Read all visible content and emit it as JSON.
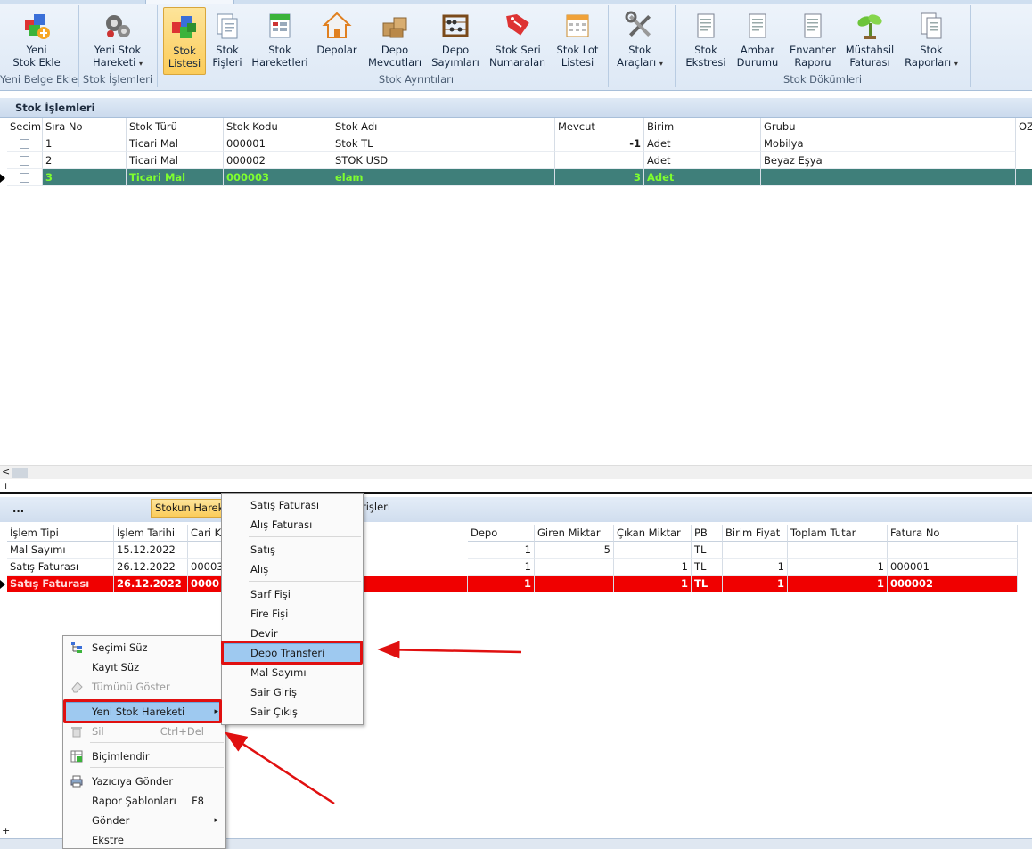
{
  "ribbon": {
    "groups": [
      {
        "label": "Yeni Belge Ekle"
      },
      {
        "label": "Stok İşlemleri"
      },
      {
        "label": "Stok Ayrıntıları"
      },
      {
        "label": "Stok Dökümleri"
      }
    ],
    "buttons": [
      {
        "line1": "Yeni",
        "line2": "Stok Ekle",
        "icon": "add-stock-icon"
      },
      {
        "line1": "Yeni Stok",
        "line2": "Hareketi",
        "icon": "gears-icon",
        "dropdown": "▾"
      },
      {
        "line1": "Stok",
        "line2": "Listesi",
        "icon": "cubes-icon"
      },
      {
        "line1": "Stok",
        "line2": "Fişleri",
        "icon": "documents-icon"
      },
      {
        "line1": "Stok",
        "line2": "Hareketleri",
        "icon": "spreadsheet-icon"
      },
      {
        "line1": "Depolar",
        "line2": "",
        "icon": "house-icon"
      },
      {
        "line1": "Depo",
        "line2": "Mevcutları",
        "icon": "boxes-icon"
      },
      {
        "line1": "Depo",
        "line2": "Sayımları",
        "icon": "abacus-icon"
      },
      {
        "line1": "Stok Seri",
        "line2": "Numaraları",
        "icon": "tag-icon"
      },
      {
        "line1": "Stok Lot",
        "line2": "Listesi",
        "icon": "calendar-icon"
      },
      {
        "line1": "Stok",
        "line2": "Araçları",
        "icon": "tools-icon",
        "dropdown": "▾"
      },
      {
        "line1": "Stok",
        "line2": "Ekstresi",
        "icon": "report-icon"
      },
      {
        "line1": "Ambar",
        "line2": "Durumu",
        "icon": "report-icon"
      },
      {
        "line1": "Envanter",
        "line2": "Raporu",
        "icon": "report-icon"
      },
      {
        "line1": "Müstahsil",
        "line2": "Faturası",
        "icon": "plant-icon"
      },
      {
        "line1": "Stok",
        "line2": "Raporları",
        "icon": "reports-icon",
        "dropdown": "▾"
      }
    ]
  },
  "stock_panel": {
    "title": "Stok İşlemleri",
    "columns": [
      "Secim",
      "Sıra No",
      "Stok Türü",
      "Stok Kodu",
      "Stok Adı",
      "Mevcut",
      "Birim",
      "Grubu",
      "OZ"
    ],
    "rows": [
      [
        "",
        "1",
        "Ticari Mal",
        "000001",
        "Stok TL",
        "-1",
        "Adet",
        "Mobilya"
      ],
      [
        "",
        "2",
        "Ticari Mal",
        "000002",
        "STOK USD",
        "",
        "Adet",
        "Beyaz Eşya"
      ],
      [
        "",
        "3",
        "Ticari Mal",
        "000003",
        "elam",
        "3",
        "Adet",
        ""
      ]
    ]
  },
  "lower_panel": {
    "more_label": "...",
    "tab_active": "Stokun Hareke",
    "tab_other": "rişleri",
    "columns": [
      "İşlem Tipi",
      "İşlem Tarihi",
      "Cari Ko",
      "Depo",
      "Giren Miktar",
      "Çıkan Miktar",
      "PB",
      "Birim Fiyat",
      "Toplam Tutar",
      "Fatura No"
    ],
    "rows": [
      [
        "Mal Sayımı",
        "15.12.2022",
        "",
        "1",
        "5",
        "",
        "TL",
        "",
        "",
        ""
      ],
      [
        "Satış Faturası",
        "26.12.2022",
        "00003",
        "1",
        "",
        "1",
        "TL",
        "1",
        "1",
        "000001"
      ],
      [
        "Satış Faturası",
        "26.12.2022",
        "0000",
        "1",
        "",
        "1",
        "TL",
        "1",
        "1",
        "000002"
      ]
    ]
  },
  "context_menu": {
    "items": [
      {
        "label": "Seçimi Süz",
        "icon": "filter-tree-icon"
      },
      {
        "label": "Kayıt Süz",
        "icon": ""
      },
      {
        "label": "Tümünü Göster",
        "icon": "eraser-icon"
      },
      {
        "label": "Yeni Stok Hareketi",
        "icon": "",
        "submenu": "▸"
      },
      {
        "label": "Sil",
        "icon": "delete-icon",
        "shortcut": "Ctrl+Del"
      },
      {
        "label": "Biçimlendir",
        "icon": "format-grid-icon"
      },
      {
        "label": "Yazıcıya Gönder",
        "icon": "printer-icon"
      },
      {
        "label": "Rapor Şablonları",
        "icon": "",
        "shortcut": "F8"
      },
      {
        "label": "Gönder",
        "icon": "",
        "submenu": "▸"
      },
      {
        "label": "Ekstre",
        "icon": ""
      }
    ]
  },
  "submenu": {
    "items": [
      "Satış Faturası",
      "Alış Faturası",
      "Satış",
      "Alış",
      "Sarf Fişi",
      "Fire Fişi",
      "Devir",
      "Depo Transferi",
      "Mal Sayımı",
      "Sair Giriş",
      "Sair Çıkış"
    ]
  },
  "colors": {
    "selected_row_bg": "#3f7f7a",
    "selected_row_text": "#7fff2f",
    "highlight_row_bg": "#f00000",
    "annotation_red": "#e01010",
    "menu_highlight": "#9ec9f0"
  },
  "misc": {
    "scroll_left": "<",
    "add_mark": "+"
  }
}
